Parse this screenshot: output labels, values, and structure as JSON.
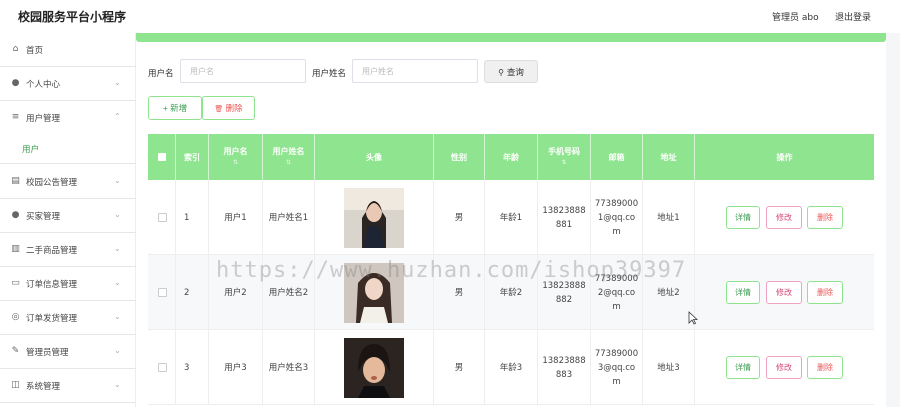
{
  "header": {
    "title": "校园服务平台小程序",
    "admin_label": "管理员 abo",
    "logout": "退出登录"
  },
  "sidebar": {
    "items": [
      {
        "icon": "home-icon",
        "glyph": "⌂",
        "label": "首页",
        "chev": ""
      },
      {
        "icon": "user-icon",
        "glyph": "●",
        "label": "个人中心",
        "chev": "⌄"
      },
      {
        "icon": "list-icon",
        "glyph": "≡",
        "label": "用户管理",
        "chev": "⌃"
      },
      {
        "icon": "notice-icon",
        "glyph": "▤",
        "label": "校园公告管理",
        "chev": "⌄"
      },
      {
        "icon": "buyer-icon",
        "glyph": "●",
        "label": "买家管理",
        "chev": "⌄"
      },
      {
        "icon": "chart-icon",
        "glyph": "▥",
        "label": "二手商品管理",
        "chev": "⌄"
      },
      {
        "icon": "order-icon",
        "glyph": "▭",
        "label": "订单信息管理",
        "chev": "⌄"
      },
      {
        "icon": "globe-icon",
        "glyph": "◎",
        "label": "订单发货管理",
        "chev": "⌄"
      },
      {
        "icon": "leaf-icon",
        "glyph": "✎",
        "label": "管理员管理",
        "chev": "⌄"
      },
      {
        "icon": "system-icon",
        "glyph": "◫",
        "label": "系统管理",
        "chev": "⌄"
      }
    ],
    "sub_item": "用户"
  },
  "search": {
    "username_label": "用户名",
    "username_placeholder": "用户名",
    "realname_label": "用户姓名",
    "realname_placeholder": "用户姓名",
    "search_button": "查询",
    "search_icon": "⚲"
  },
  "actions": {
    "add": "新增",
    "add_icon": "+",
    "delete": "删除",
    "delete_icon": "🗑"
  },
  "table": {
    "headers": [
      "索引",
      "用户名",
      "用户姓名",
      "头像",
      "性别",
      "年龄",
      "手机号码",
      "邮箱",
      "地址",
      "操作"
    ],
    "sort_glyph": "⇅",
    "rows": [
      {
        "index": "1",
        "username": "用户1",
        "realname": "用户姓名1",
        "gender": "男",
        "age": "年龄1",
        "phone": "13823888881",
        "phone_l1": "13823888",
        "phone_l2": "881",
        "email_l1": "77389000",
        "email_l2": "1@qq.co",
        "email_l3": "m",
        "address": "地址1"
      },
      {
        "index": "2",
        "username": "用户2",
        "realname": "用户姓名2",
        "gender": "男",
        "age": "年龄2",
        "phone_l1": "13823888",
        "phone_l2": "882",
        "email_l1": "77389000",
        "email_l2": "2@qq.co",
        "email_l3": "m",
        "address": "地址2"
      },
      {
        "index": "3",
        "username": "用户3",
        "realname": "用户姓名3",
        "gender": "男",
        "age": "年龄3",
        "phone_l1": "13823888",
        "phone_l2": "883",
        "email_l1": "77389000",
        "email_l2": "3@qq.co",
        "email_l3": "m",
        "address": "地址3"
      }
    ],
    "row_actions": {
      "detail": "详情",
      "edit": "修改",
      "remove": "删除"
    }
  },
  "watermark": "https://www.huzhan.com/ishop39397",
  "colors": {
    "accent": "#8fe58f",
    "accent_text": "#3a9d4f",
    "danger": "#e55",
    "edit": "#d44a7c"
  }
}
